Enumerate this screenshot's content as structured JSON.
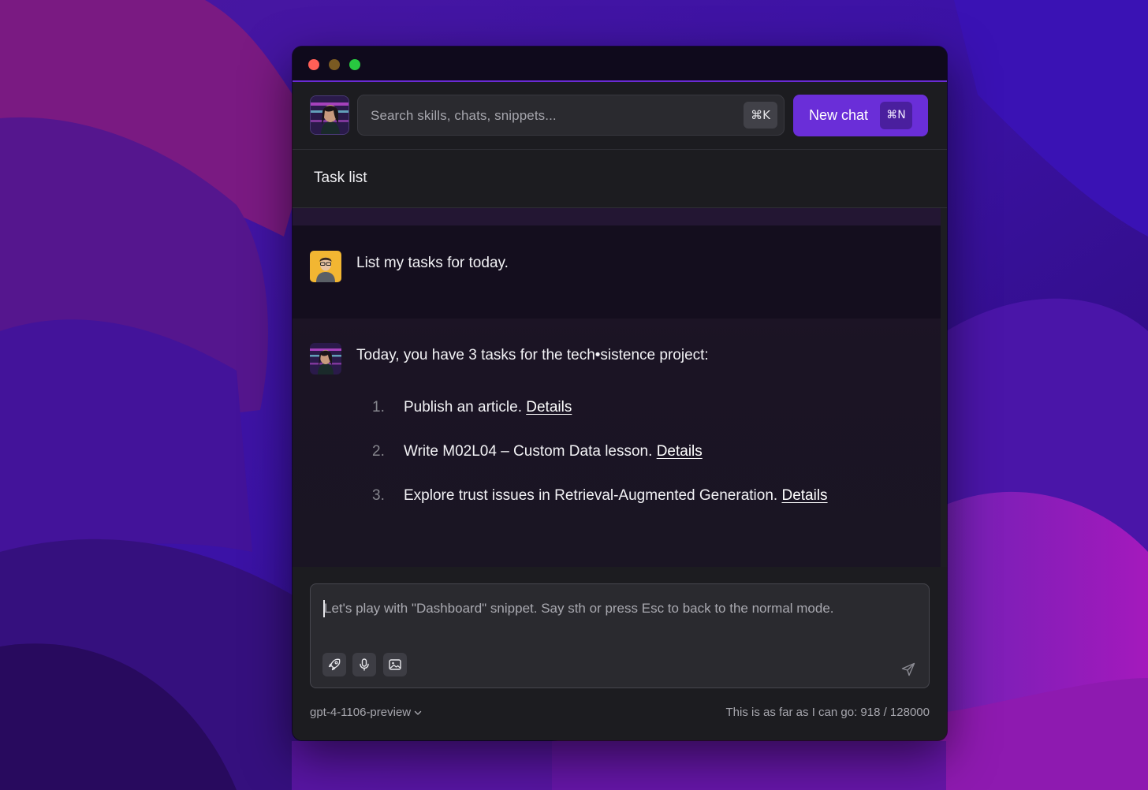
{
  "window": {
    "traffic_lights": [
      "close",
      "minimize",
      "maximize"
    ]
  },
  "toolbar": {
    "search_placeholder": "Search skills, chats, snippets...",
    "search_shortcut": "⌘K",
    "new_chat_label": "New chat",
    "new_chat_shortcut": "⌘N"
  },
  "header": {
    "title": "Task list"
  },
  "conversation": {
    "user_message": "List my tasks for today.",
    "assistant_intro": "Today, you have 3 tasks for the tech•sistence project:",
    "tasks": [
      {
        "number": "1.",
        "text": "Publish an article.",
        "link": "Details"
      },
      {
        "number": "2.",
        "text": "Write M02L04 – Custom Data lesson.",
        "link": "Details"
      },
      {
        "number": "3.",
        "text": "Explore trust issues in Retrieval-Augmented Generation.",
        "link": "Details"
      }
    ]
  },
  "composer": {
    "placeholder": "Let's play with \"Dashboard\" snippet. Say sth or press Esc to back to the normal mode.",
    "tools": [
      "rocket-icon",
      "microphone-icon",
      "image-icon"
    ],
    "send_icon": "send-icon"
  },
  "footer": {
    "model": "gpt-4-1106-preview",
    "token_status": "This is as far as I can go: 918 / 128000"
  },
  "colors": {
    "accent": "#6a2ed8",
    "window_bg": "#1c1c20",
    "wallpaper_primary": "#3a0f8a",
    "wallpaper_magenta": "#9a1aa8"
  }
}
